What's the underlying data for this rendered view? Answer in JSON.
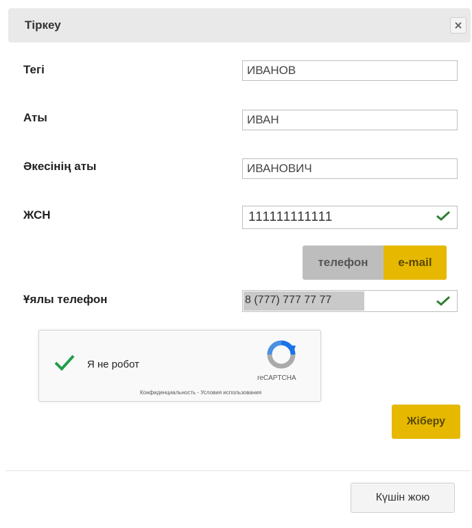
{
  "dialog": {
    "title": "Тіркеу",
    "close_label": "×"
  },
  "fields": {
    "surname": {
      "label": "Тегі",
      "value": "ИВАНОВ"
    },
    "name": {
      "label": "Аты",
      "value": "ИВАН"
    },
    "patronymic": {
      "label": "Әкесінің аты",
      "value": "ИВАНОВИЧ"
    },
    "iin": {
      "label": "ЖСН",
      "value": "111111111111"
    },
    "mobile": {
      "label": "Ұялы телефон",
      "value": "8 (777) 777 77 77"
    }
  },
  "contact_toggle": {
    "phone_label": "телефон",
    "email_label": "e-mail",
    "selected": "e-mail"
  },
  "recaptcha": {
    "label": "Я не робот",
    "brand": "reCAPTCHA",
    "links": "Конфиденциальность - Условия использования"
  },
  "buttons": {
    "submit_label": "Жіберу",
    "force_close_label": "Күшін жою"
  },
  "colors": {
    "accent": "#e6b800",
    "check_green": "#2e7d32",
    "titlebar_bg": "#e9e9e9"
  }
}
